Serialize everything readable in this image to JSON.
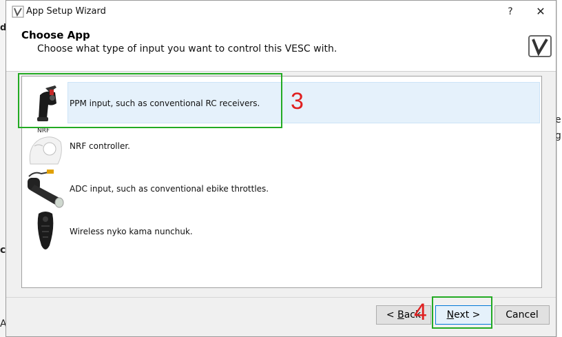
{
  "window": {
    "title": "App Setup Wizard",
    "help": "?",
    "close": "✕"
  },
  "header": {
    "title": "Choose App",
    "subtitle": "Choose what type of input you want to control this VESC with."
  },
  "apps": [
    {
      "label": "PPM input, such as conventional RC receivers.",
      "icon": "rc-transmitter-icon",
      "selected": true
    },
    {
      "label": "NRF controller.",
      "icon": "nrf-remote-icon",
      "icon_text": "NRF",
      "selected": false
    },
    {
      "label": "ADC input, such as conventional ebike throttles.",
      "icon": "throttle-grip-icon",
      "selected": false
    },
    {
      "label": "Wireless nyko kama nunchuk.",
      "icon": "nunchuk-icon",
      "selected": false
    }
  ],
  "buttons": {
    "back_prefix": "< ",
    "back_key": "B",
    "back_rest": "ack",
    "next_key": "N",
    "next_rest": "ext >",
    "cancel": "Cancel"
  },
  "annotations": {
    "step3": "3",
    "step4": "4"
  },
  "background": {
    "frag1": "ds",
    "frag2": "e",
    "frag3": "g",
    "frag4": "A",
    "frag5": "c"
  },
  "colors": {
    "selection": "#e5f1fb",
    "annotation_box": "#22aa22",
    "annotation_text": "#e02020"
  }
}
